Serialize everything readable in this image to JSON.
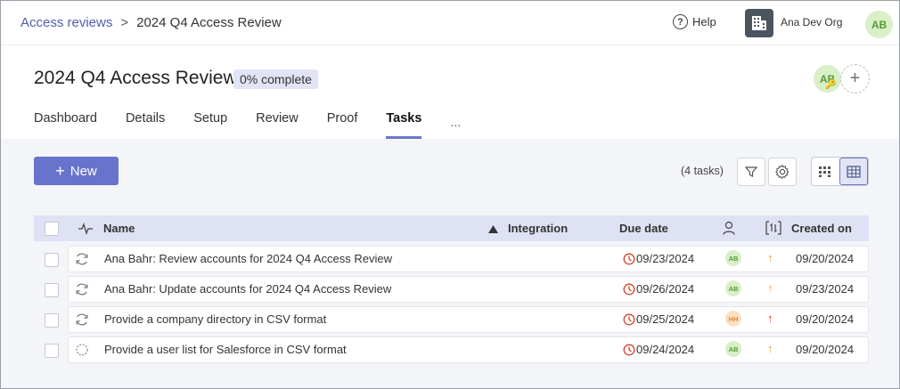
{
  "breadcrumb": {
    "parent": "Access reviews",
    "separator": ">",
    "current": "2024 Q4 Access Review"
  },
  "topbar": {
    "help_label": "Help",
    "org_name": "Ana Dev Org",
    "user_initials": "AB"
  },
  "header": {
    "title": "2024 Q4 Access Review",
    "progress": "0% complete",
    "owner_initials": "AB",
    "add_owner": "+"
  },
  "tabs": [
    {
      "label": "Dashboard",
      "active": false
    },
    {
      "label": "Details",
      "active": false
    },
    {
      "label": "Setup",
      "active": false
    },
    {
      "label": "Review",
      "active": false
    },
    {
      "label": "Proof",
      "active": false
    },
    {
      "label": "Tasks",
      "active": true
    }
  ],
  "tabs_more": "...",
  "toolbar": {
    "new_label": "New",
    "task_count": "(4 tasks)"
  },
  "table": {
    "columns": {
      "name": "Name",
      "integration": "Integration",
      "due_date": "Due date",
      "created_on": "Created on"
    },
    "rows": [
      {
        "name": "Ana Bahr: Review accounts for 2024 Q4 Access Review",
        "due": "09/23/2024",
        "assignee": "AB",
        "assignee_color": "green",
        "priority_color": "#f0a030",
        "created": "09/20/2024",
        "status": "recurring"
      },
      {
        "name": "Ana Bahr: Update accounts for 2024 Q4 Access Review",
        "due": "09/26/2024",
        "assignee": "AB",
        "assignee_color": "green",
        "priority_color": "#f5b050",
        "created": "09/23/2024",
        "status": "recurring"
      },
      {
        "name": "Provide a company directory in CSV format",
        "due": "09/25/2024",
        "assignee": "HH",
        "assignee_color": "orange",
        "priority_color": "#d9402b",
        "created": "09/20/2024",
        "status": "recurring"
      },
      {
        "name": "Provide a user list for Salesforce in CSV format",
        "due": "09/24/2024",
        "assignee": "AB",
        "assignee_color": "green",
        "priority_color": "#f0a030",
        "created": "09/20/2024",
        "status": "pending"
      }
    ]
  },
  "colors": {
    "accent": "#6873cc",
    "header_bg": "#dfe2f4",
    "overdue": "#d9402b"
  }
}
